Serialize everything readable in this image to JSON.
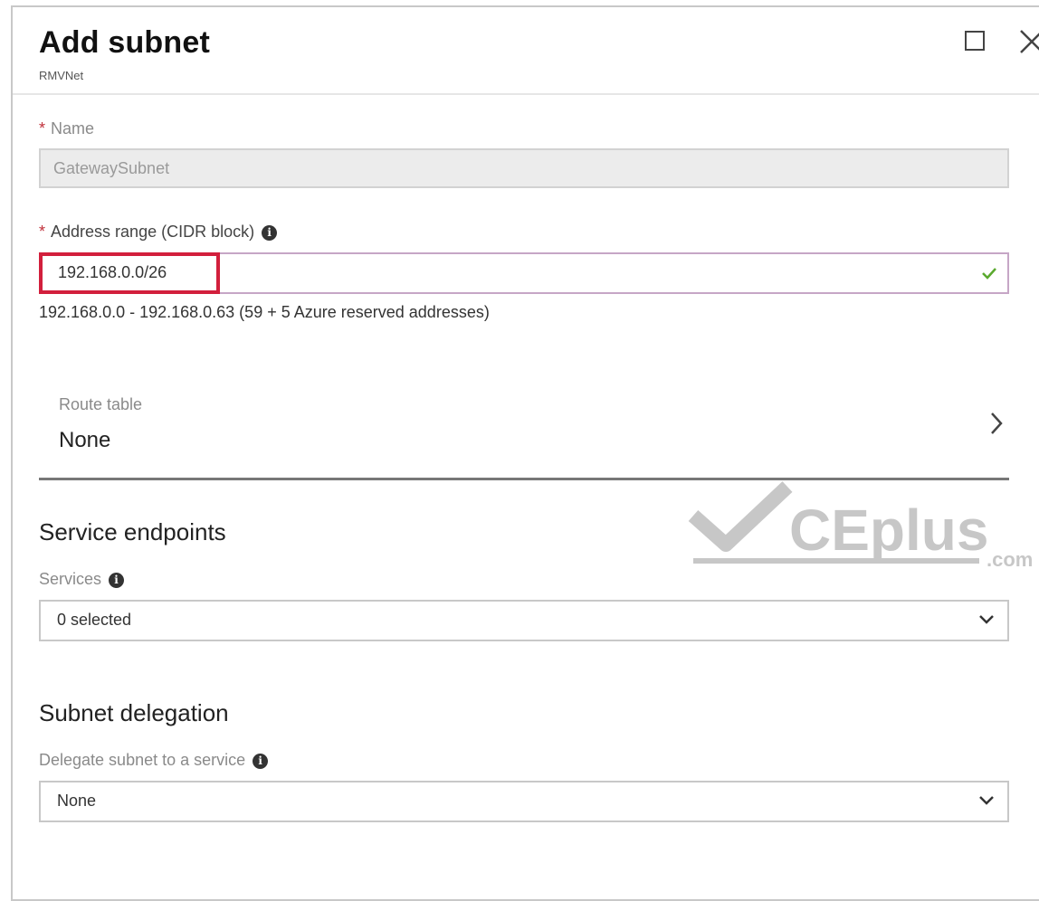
{
  "header": {
    "title": "Add subnet",
    "subtitle": "RMVNet"
  },
  "name_field": {
    "label": "Name",
    "value": "GatewaySubnet"
  },
  "address_field": {
    "label": "Address range (CIDR block)",
    "value": "192.168.0.0/26",
    "range_text": "192.168.0.0 - 192.168.0.63 (59 + 5 Azure reserved addresses)"
  },
  "route_table": {
    "label": "Route table",
    "value": "None"
  },
  "service_endpoints": {
    "title": "Service endpoints",
    "services_label": "Services",
    "services_value": "0 selected"
  },
  "subnet_delegation": {
    "title": "Subnet delegation",
    "delegate_label": "Delegate subnet to a service",
    "delegate_value": "None"
  },
  "watermark": {
    "text": "CEplus",
    "suffix": ".com"
  },
  "colors": {
    "required": "#c0303a",
    "highlight_box": "#d21f3c",
    "valid_check": "#5aa92e"
  }
}
